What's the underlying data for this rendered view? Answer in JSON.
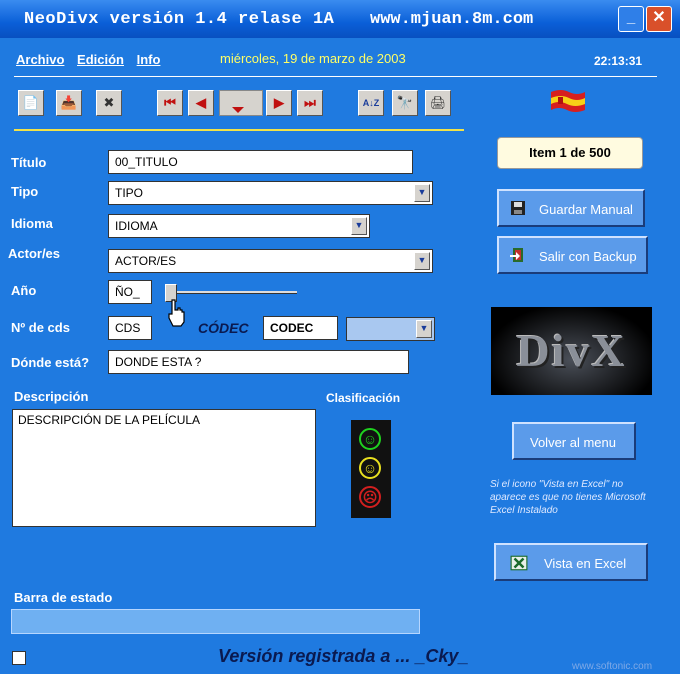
{
  "window": {
    "title": "NeoDivx versión   1.4 relase  1A",
    "url": "www.mjuan.8m.com",
    "minimize_glyph": "_",
    "close_glyph": "✕"
  },
  "menu": [
    "Archivo",
    "Edición",
    "Info"
  ],
  "date": "miércoles, 19 de marzo de 2003",
  "clock": "22:13:31",
  "toolbar": {
    "new_icon": "📄",
    "save_icon": "📥",
    "delete_icon": "✖",
    "first_icon": "⏮",
    "prev_icon": "◀",
    "next_icon": "▶",
    "last_icon": "⏭",
    "sort_icon": "A↓Z",
    "find_icon": "🔭",
    "print_icon": "🖨"
  },
  "form": {
    "titulo_label": "Título",
    "titulo_value": "00_TITULO",
    "tipo_label": "Tipo",
    "tipo_value": "TIPO",
    "idioma_label": "Idioma",
    "idioma_value": "IDIOMA",
    "actor_label": "Actor/es",
    "actor_value": "ACTOR/ES",
    "anio_label": "Año",
    "anio_value": "ÑO_",
    "cds_label": "Nº de cds",
    "cds_value": "CDS",
    "codec_label": "CÓDEC",
    "codec_value": "CODEC",
    "donde_label": "Dónde está?",
    "donde_value": "DONDE ESTA ?",
    "descripcion_label": "Descripción",
    "descripcion_value": "DESCRIPCIÓN DE LA PELÍCULA",
    "clasificacion_label": "Clasificación",
    "estado_label": "Barra de estado"
  },
  "right": {
    "item_counter": "Item 1 de 500",
    "guardar_label": "Guardar Manual",
    "salir_label": "Salir con Backup",
    "volver_label": "Volver al menu",
    "excel_note": "Si el icono \"Vista en Excel\" no aparece es que no tienes Microsoft Excel Instalado",
    "excel_label": "Vista en Excel",
    "logo_text": "DivX"
  },
  "footer": {
    "registered": "Versión registrada a ... _Cky_",
    "watermark": "www.softonic.com"
  },
  "colors": {
    "background": "#1f7ae0",
    "date_text": "#ffff66",
    "separator": "#f1e24a"
  }
}
